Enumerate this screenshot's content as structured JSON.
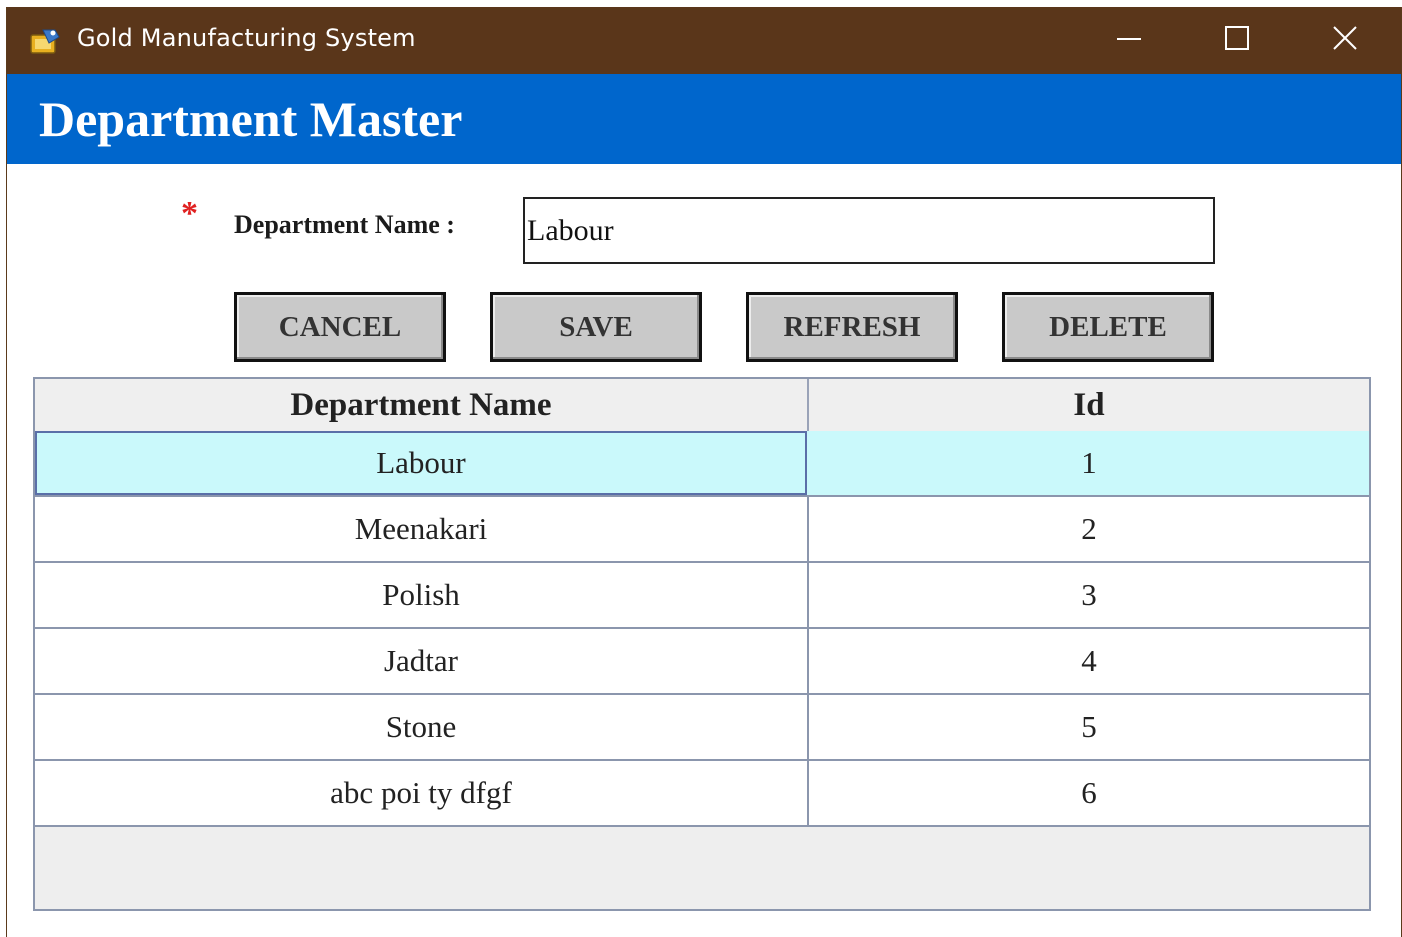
{
  "window": {
    "title": "Gold Manufacturing System",
    "controls": {
      "minimize": "minimize-icon",
      "maximize": "maximize-icon",
      "close": "close-icon"
    },
    "titlebar_color": "#5a361a"
  },
  "header": {
    "title": "Department Master",
    "color": "#0066cc"
  },
  "form": {
    "required_marker": "*",
    "label": "Department Name :",
    "value": "Labour"
  },
  "buttons": {
    "cancel": "CANCEL",
    "save": "SAVE",
    "refresh": "REFRESH",
    "delete": "DELETE"
  },
  "grid": {
    "columns": [
      "Department Name",
      "Id"
    ],
    "rows": [
      {
        "name": "Labour",
        "id": "1"
      },
      {
        "name": "Meenakari",
        "id": "2"
      },
      {
        "name": "Polish",
        "id": "3"
      },
      {
        "name": "Jadtar",
        "id": "4"
      },
      {
        "name": "Stone",
        "id": "5"
      },
      {
        "name": "abc poi ty dfgf",
        "id": "6"
      }
    ],
    "selected_row": 0,
    "selected_color": "#caf9fb"
  }
}
